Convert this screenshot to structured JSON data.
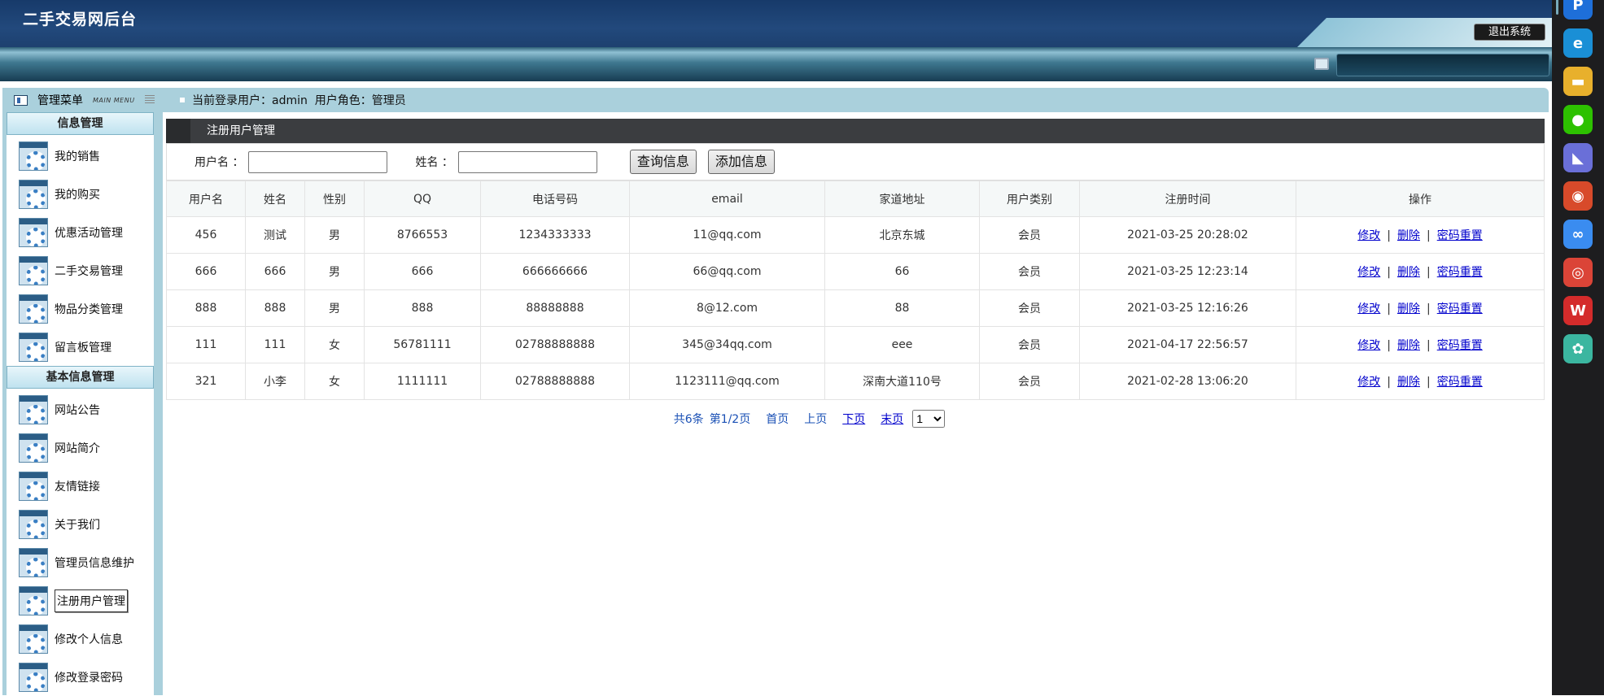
{
  "app": {
    "title": "二手交易网后台",
    "logout_label": "退出系统"
  },
  "sidebar": {
    "menu_title": "管理菜单",
    "menu_subtitle": "MAIN MENU",
    "sections": [
      {
        "title": "信息管理",
        "items": [
          "我的销售",
          "我的购买",
          "优惠活动管理",
          "二手交易管理",
          "物品分类管理",
          "留言板管理"
        ]
      },
      {
        "title": "基本信息管理",
        "items": [
          "网站公告",
          "网站简介",
          "友情链接",
          "关于我们",
          "管理员信息维护",
          "注册用户管理",
          "修改个人信息",
          "修改登录密码"
        ]
      }
    ],
    "active_item": "注册用户管理"
  },
  "userbar": {
    "text": "当前登录用户：admin  用户角色：管理员"
  },
  "panel": {
    "title": "注册用户管理"
  },
  "search": {
    "username_label": "用户名 ：",
    "username_value": "",
    "name_label": "姓名 ：",
    "name_value": "",
    "query_button": "查询信息",
    "add_button": "添加信息"
  },
  "table": {
    "columns": [
      "用户名",
      "姓名",
      "性别",
      "QQ",
      "电话号码",
      "email",
      "家道地址",
      "用户类别",
      "注册时间",
      "操作"
    ],
    "rows": [
      [
        "456",
        "测试",
        "男",
        "8766553",
        "1234333333",
        "11@qq.com",
        "北京东城",
        "会员",
        "2021-03-25 20:28:02"
      ],
      [
        "666",
        "666",
        "男",
        "666",
        "666666666",
        "66@qq.com",
        "66",
        "会员",
        "2021-03-25 12:23:14"
      ],
      [
        "888",
        "888",
        "男",
        "888",
        "88888888",
        "8@12.com",
        "88",
        "会员",
        "2021-03-25 12:16:26"
      ],
      [
        "111",
        "111",
        "女",
        "56781111",
        "02788888888",
        "345@34qq.com",
        "eee",
        "会员",
        "2021-04-17 22:56:57"
      ],
      [
        "321",
        "小李",
        "女",
        "1111111",
        "02788888888",
        "1123111@qq.com",
        "深南大道110号",
        "会员",
        "2021-02-28 13:06:20"
      ]
    ],
    "actions": [
      "修改",
      "删除",
      "密码重置"
    ],
    "action_sep": "|"
  },
  "pager": {
    "total": "共6条",
    "page": "第1/2页",
    "first": "首页",
    "prev": "上页",
    "next": "下页",
    "last": "末页",
    "selected": "1"
  },
  "taskbar": {
    "icons": [
      {
        "name": "p-app-icon",
        "color": "#1e6fd9",
        "glyph": "P"
      },
      {
        "name": "edge-icon",
        "color": "#1a8fd6",
        "glyph": "e"
      },
      {
        "name": "folder-icon",
        "color": "#e8b02c",
        "glyph": "▬"
      },
      {
        "name": "wechat-icon",
        "color": "#2dc100",
        "glyph": "●"
      },
      {
        "name": "dolphin-icon",
        "color": "#6a6fd8",
        "glyph": "◣"
      },
      {
        "name": "camera-icon",
        "color": "#d84a2a",
        "glyph": "◉"
      },
      {
        "name": "baidu-netdisk-icon",
        "color": "#3a8cf0",
        "glyph": "∞"
      },
      {
        "name": "chrome-icon",
        "color": "#db4437",
        "glyph": "◎"
      },
      {
        "name": "wps-icon",
        "color": "#d42b2b",
        "glyph": "W"
      },
      {
        "name": "clover-icon",
        "color": "#3bb6a0",
        "glyph": "✿"
      }
    ]
  }
}
